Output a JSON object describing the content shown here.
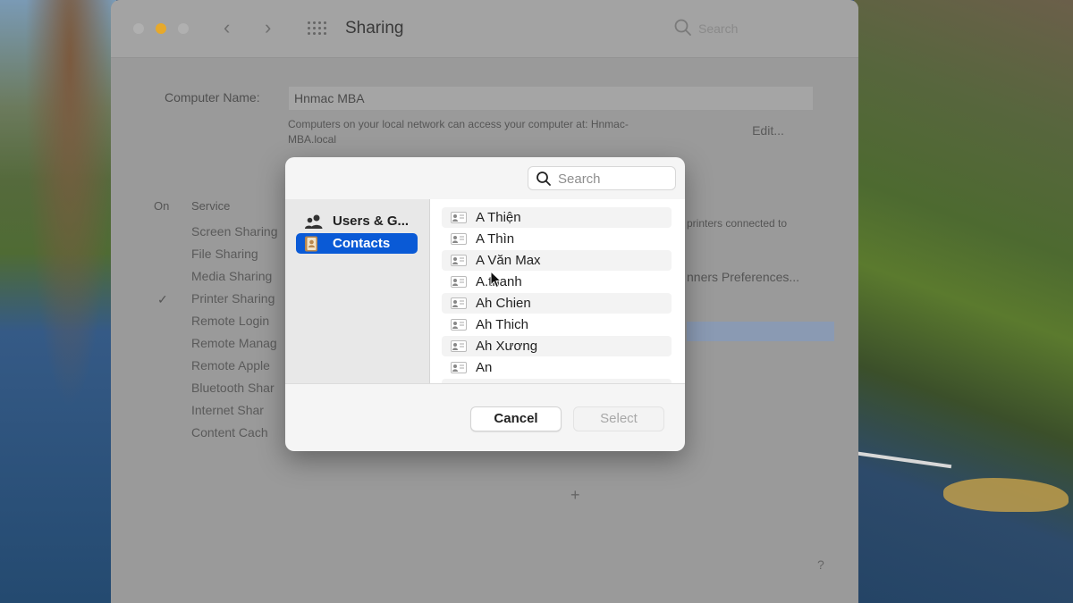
{
  "window": {
    "title": "Sharing",
    "search_placeholder": "Search",
    "computer_name_label": "Computer Name:",
    "computer_name_value": "Hnmac MBA",
    "computer_name_desc": "Computers on your local network can access your computer at: Hnmac-MBA.local",
    "edit_label": "Edit...",
    "col_on": "On",
    "col_service": "Service",
    "services": [
      "Screen Sharing",
      "File Sharing",
      "Media Sharing",
      "Printer Sharing",
      "Remote Login",
      "Remote Manag",
      "Remote Apple",
      "Bluetooth Shar",
      "Internet Shar",
      "Content Cach"
    ],
    "checkmark": "✓",
    "right_desc": "printers connected to",
    "prefs_button": "nners Preferences...",
    "plus": "+",
    "help": "?"
  },
  "dialog": {
    "search_placeholder": "Search",
    "sidebar": [
      {
        "label": "Users & G...",
        "icon": "users-icon"
      },
      {
        "label": "Contacts",
        "icon": "contacts-book-icon",
        "selected": true
      }
    ],
    "contacts": [
      "A Thiện",
      "A Thìn",
      "A Văn Max",
      "A.thanh",
      "Ah Chien",
      "Ah Thich",
      "Ah Xương",
      "An"
    ],
    "cancel_label": "Cancel",
    "select_label": "Select"
  },
  "colors": {
    "accent": "#0a5ad6",
    "traffic_yellow": "#e7a92b"
  }
}
